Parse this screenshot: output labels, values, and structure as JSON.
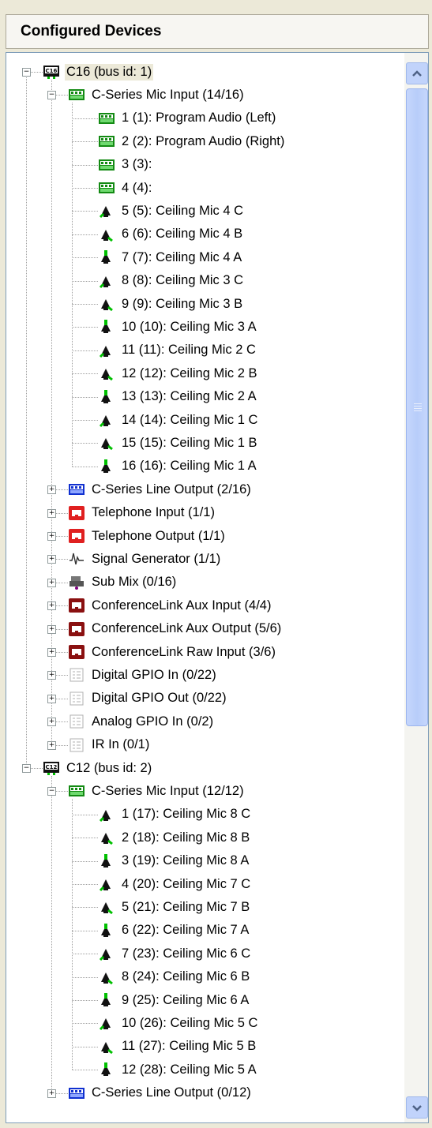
{
  "panel": {
    "title": "Configured Devices"
  },
  "tree": [
    {
      "level": 0,
      "icon": "c16-device-icon",
      "label": "C16 (bus id: 1)",
      "expander": "-",
      "selected": true,
      "badge": "C16"
    },
    {
      "level": 1,
      "icon": "mic-input-group-icon",
      "label": "C-Series Mic Input (14/16)",
      "expander": "-"
    },
    {
      "level": 2,
      "icon": "mic-input-channel-icon",
      "label": "1 (1): Program Audio (Left)"
    },
    {
      "level": 2,
      "icon": "mic-input-channel-icon",
      "label": "2 (2): Program Audio (Right)"
    },
    {
      "level": 2,
      "icon": "mic-input-channel-icon",
      "label": "3 (3):"
    },
    {
      "level": 2,
      "icon": "mic-input-channel-icon",
      "label": "4 (4):"
    },
    {
      "level": 2,
      "icon": "ceiling-mic-icon",
      "label": "5 (5): Ceiling Mic 4 C",
      "mic": "c"
    },
    {
      "level": 2,
      "icon": "ceiling-mic-icon",
      "label": "6 (6): Ceiling Mic 4 B",
      "mic": "b"
    },
    {
      "level": 2,
      "icon": "ceiling-mic-icon",
      "label": "7 (7): Ceiling Mic 4 A",
      "mic": "a"
    },
    {
      "level": 2,
      "icon": "ceiling-mic-icon",
      "label": "8 (8): Ceiling Mic 3 C",
      "mic": "c"
    },
    {
      "level": 2,
      "icon": "ceiling-mic-icon",
      "label": "9 (9): Ceiling Mic 3 B",
      "mic": "b"
    },
    {
      "level": 2,
      "icon": "ceiling-mic-icon",
      "label": "10 (10): Ceiling Mic 3 A",
      "mic": "a"
    },
    {
      "level": 2,
      "icon": "ceiling-mic-icon",
      "label": "11 (11): Ceiling Mic 2 C",
      "mic": "c"
    },
    {
      "level": 2,
      "icon": "ceiling-mic-icon",
      "label": "12 (12): Ceiling Mic 2 B",
      "mic": "b"
    },
    {
      "level": 2,
      "icon": "ceiling-mic-icon",
      "label": "13 (13): Ceiling Mic 2 A",
      "mic": "a"
    },
    {
      "level": 2,
      "icon": "ceiling-mic-icon",
      "label": "14 (14): Ceiling Mic 1 C",
      "mic": "c"
    },
    {
      "level": 2,
      "icon": "ceiling-mic-icon",
      "label": "15 (15): Ceiling Mic 1 B",
      "mic": "b"
    },
    {
      "level": 2,
      "icon": "ceiling-mic-icon",
      "label": "16 (16): Ceiling Mic 1 A",
      "mic": "a"
    },
    {
      "level": 1,
      "icon": "line-output-icon",
      "label": "C-Series Line Output (2/16)",
      "expander": "+"
    },
    {
      "level": 1,
      "icon": "telephone-icon",
      "label": "Telephone Input (1/1)",
      "expander": "+"
    },
    {
      "level": 1,
      "icon": "telephone-icon",
      "label": "Telephone Output (1/1)",
      "expander": "+"
    },
    {
      "level": 1,
      "icon": "signal-generator-icon",
      "label": "Signal Generator (1/1)",
      "expander": "+"
    },
    {
      "level": 1,
      "icon": "sub-mix-icon",
      "label": "Sub Mix (0/16)",
      "expander": "+"
    },
    {
      "level": 1,
      "icon": "conferencelink-icon",
      "label": "ConferenceLink Aux Input (4/4)",
      "expander": "+"
    },
    {
      "level": 1,
      "icon": "conferencelink-icon",
      "label": "ConferenceLink Aux Output (5/6)",
      "expander": "+"
    },
    {
      "level": 1,
      "icon": "conferencelink-icon",
      "label": "ConferenceLink Raw Input (3/6)",
      "expander": "+"
    },
    {
      "level": 1,
      "icon": "gpio-icon",
      "label": "Digital GPIO In (0/22)",
      "expander": "+"
    },
    {
      "level": 1,
      "icon": "gpio-icon",
      "label": "Digital GPIO Out (0/22)",
      "expander": "+"
    },
    {
      "level": 1,
      "icon": "gpio-icon",
      "label": "Analog GPIO In (0/2)",
      "expander": "+"
    },
    {
      "level": 1,
      "icon": "gpio-icon",
      "label": "IR In (0/1)",
      "expander": "+"
    },
    {
      "level": 0,
      "icon": "c12-device-icon",
      "label": "C12 (bus id: 2)",
      "expander": "-",
      "badge": "C12"
    },
    {
      "level": 1,
      "icon": "mic-input-group-icon",
      "label": "C-Series Mic Input (12/12)",
      "expander": "-"
    },
    {
      "level": 2,
      "icon": "ceiling-mic-icon",
      "label": "1 (17): Ceiling Mic 8 C",
      "mic": "c"
    },
    {
      "level": 2,
      "icon": "ceiling-mic-icon",
      "label": "2 (18): Ceiling Mic 8 B",
      "mic": "b"
    },
    {
      "level": 2,
      "icon": "ceiling-mic-icon",
      "label": "3 (19): Ceiling Mic 8 A",
      "mic": "a"
    },
    {
      "level": 2,
      "icon": "ceiling-mic-icon",
      "label": "4 (20): Ceiling Mic 7 C",
      "mic": "c"
    },
    {
      "level": 2,
      "icon": "ceiling-mic-icon",
      "label": "5 (21): Ceiling Mic 7 B",
      "mic": "b"
    },
    {
      "level": 2,
      "icon": "ceiling-mic-icon",
      "label": "6 (22): Ceiling Mic 7 A",
      "mic": "a"
    },
    {
      "level": 2,
      "icon": "ceiling-mic-icon",
      "label": "7 (23): Ceiling Mic 6 C",
      "mic": "c"
    },
    {
      "level": 2,
      "icon": "ceiling-mic-icon",
      "label": "8 (24): Ceiling Mic 6 B",
      "mic": "b"
    },
    {
      "level": 2,
      "icon": "ceiling-mic-icon",
      "label": "9 (25): Ceiling Mic 6 A",
      "mic": "a"
    },
    {
      "level": 2,
      "icon": "ceiling-mic-icon",
      "label": "10 (26): Ceiling Mic 5 C",
      "mic": "c"
    },
    {
      "level": 2,
      "icon": "ceiling-mic-icon",
      "label": "11 (27): Ceiling Mic 5 B",
      "mic": "b"
    },
    {
      "level": 2,
      "icon": "ceiling-mic-icon",
      "label": "12 (28): Ceiling Mic 5 A",
      "mic": "a"
    },
    {
      "level": 1,
      "icon": "line-output-icon",
      "label": "C-Series Line Output (0/12)",
      "expander": "+"
    }
  ],
  "colors": {
    "selection": "#ece9d8",
    "mic_green": "#00c000",
    "line_blue": "#2040e0",
    "phone_red": "#e02020"
  },
  "scrollbar": {
    "up_icon": "scroll-up-arrow-icon",
    "down_icon": "scroll-down-arrow-icon"
  }
}
